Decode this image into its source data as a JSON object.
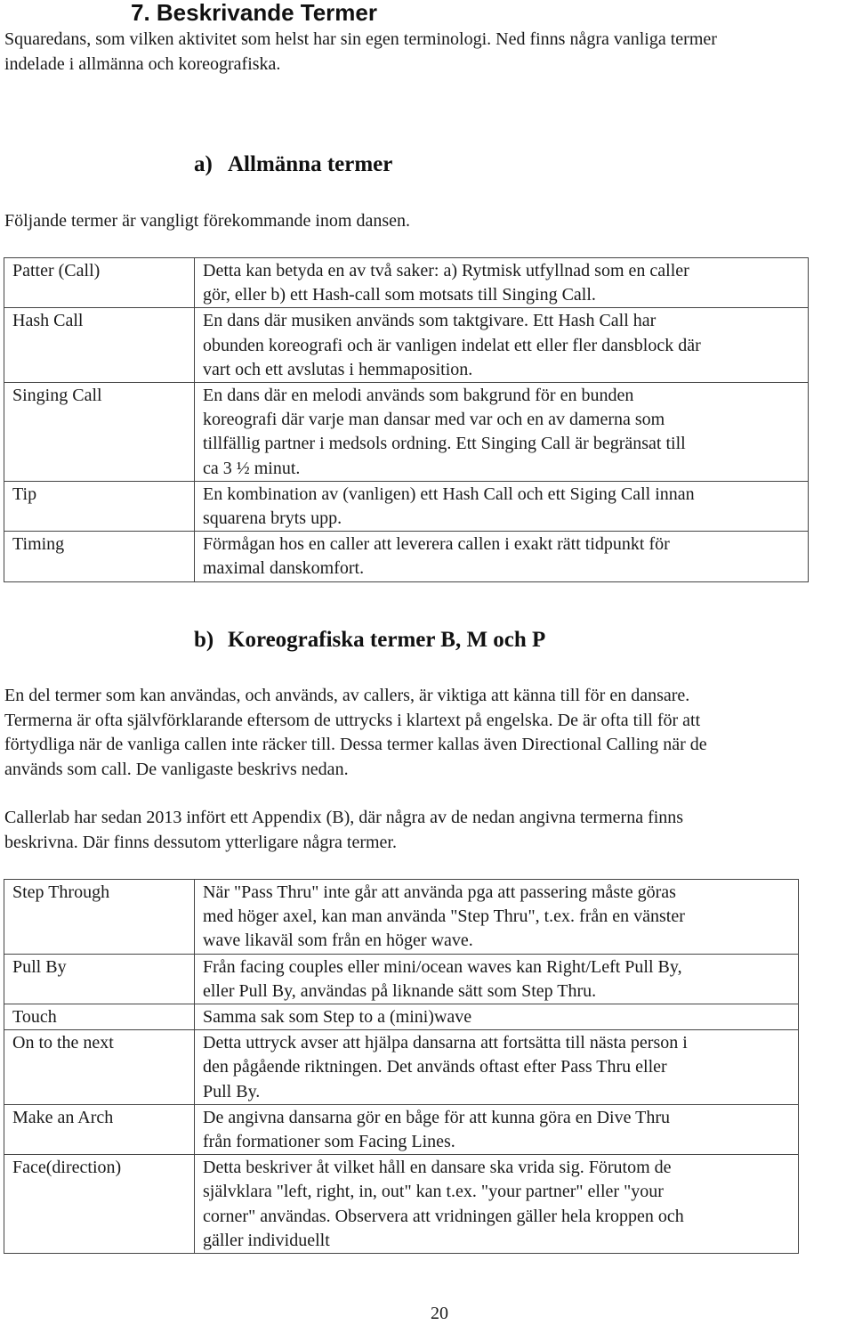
{
  "section_title": "7. Beskrivande Termer",
  "intro": [
    "Squaredans, som vilken aktivitet som helst har sin egen terminologi. Ned finns några vanliga termer",
    "indelade i allmänna och koreografiska."
  ],
  "general": {
    "heading_num": "a)",
    "heading_text": "Allmänna termer",
    "lead": "Följande termer är vangligt förekommande inom dansen.",
    "rows": [
      {
        "term": "Patter (Call)",
        "desc": [
          "Detta kan betyda en av två saker: a) Rytmisk utfyllnad som en caller",
          "gör, eller b) ett Hash-call som motsats till Singing Call."
        ]
      },
      {
        "term": "Hash Call",
        "desc": [
          "En dans där musiken används som taktgivare. Ett Hash Call har",
          "obunden koreografi och är vanligen indelat ett eller fler dansblock där",
          "vart och ett avslutas i hemmaposition."
        ]
      },
      {
        "term": "Singing Call",
        "desc": [
          "En dans där en melodi används som bakgrund för en bunden",
          "koreografi där varje man dansar med var och en av damerna som",
          "tillfällig partner i medsols ordning. Ett Singing Call är begränsat till",
          "ca 3 ½ minut."
        ]
      },
      {
        "term": "Tip",
        "desc": [
          "En kombination av (vanligen) ett Hash Call och ett Siging Call innan",
          "squarena bryts upp."
        ]
      },
      {
        "term": "Timing",
        "desc": [
          "Förmågan hos en caller att leverera callen i exakt rätt tidpunkt för",
          "maximal danskomfort."
        ]
      }
    ]
  },
  "choreo": {
    "heading_num": "b)",
    "heading_text": "Koreografiska termer B, M och P",
    "para1": [
      "En del termer som kan användas, och används, av callers, är viktiga att känna till för en dansare.",
      "Termerna är ofta självförklarande eftersom de uttrycks i klartext på engelska. De är ofta till för att",
      "förtydliga när de vanliga callen inte räcker till. Dessa termer kallas även Directional Calling när de",
      "används som call. De vanligaste beskrivs nedan."
    ],
    "para2": [
      "Callerlab har sedan 2013 infört ett Appendix (B), där några av de nedan angivna termerna finns",
      "beskrivna. Där finns dessutom ytterligare några termer."
    ],
    "rows": [
      {
        "term": "Step Through",
        "desc": [
          "När \"Pass Thru\" inte går att använda pga att passering måste göras",
          "med höger axel, kan man använda \"Step Thru\", t.ex. från en vänster",
          "wave likaväl som från en höger wave."
        ]
      },
      {
        "term": "Pull By",
        "desc": [
          "Från facing couples eller mini/ocean waves kan Right/Left Pull By,",
          "eller Pull By, användas på liknande sätt som Step Thru."
        ]
      },
      {
        "term": "Touch",
        "desc": [
          "Samma sak som Step to a (mini)wave"
        ]
      },
      {
        "term": "On to the next",
        "desc": [
          "Detta uttryck avser att hjälpa dansarna att fortsätta till nästa person i",
          "den pågående riktningen. Det används oftast efter Pass Thru eller",
          "Pull By."
        ]
      },
      {
        "term": "Make an Arch",
        "desc": [
          "De angivna dansarna gör en båge för att kunna göra en Dive Thru",
          "från formationer som Facing Lines."
        ]
      },
      {
        "term": "Face(direction)",
        "desc": [
          "Detta beskriver åt vilket håll en dansare ska vrida sig. Förutom de",
          "självklara \"left, right, in, out\" kan t.ex. \"your partner\" eller \"your",
          "corner\" användas. Observera att vridningen gäller hela kroppen och",
          "gäller individuellt"
        ]
      }
    ]
  },
  "page_number": "20"
}
